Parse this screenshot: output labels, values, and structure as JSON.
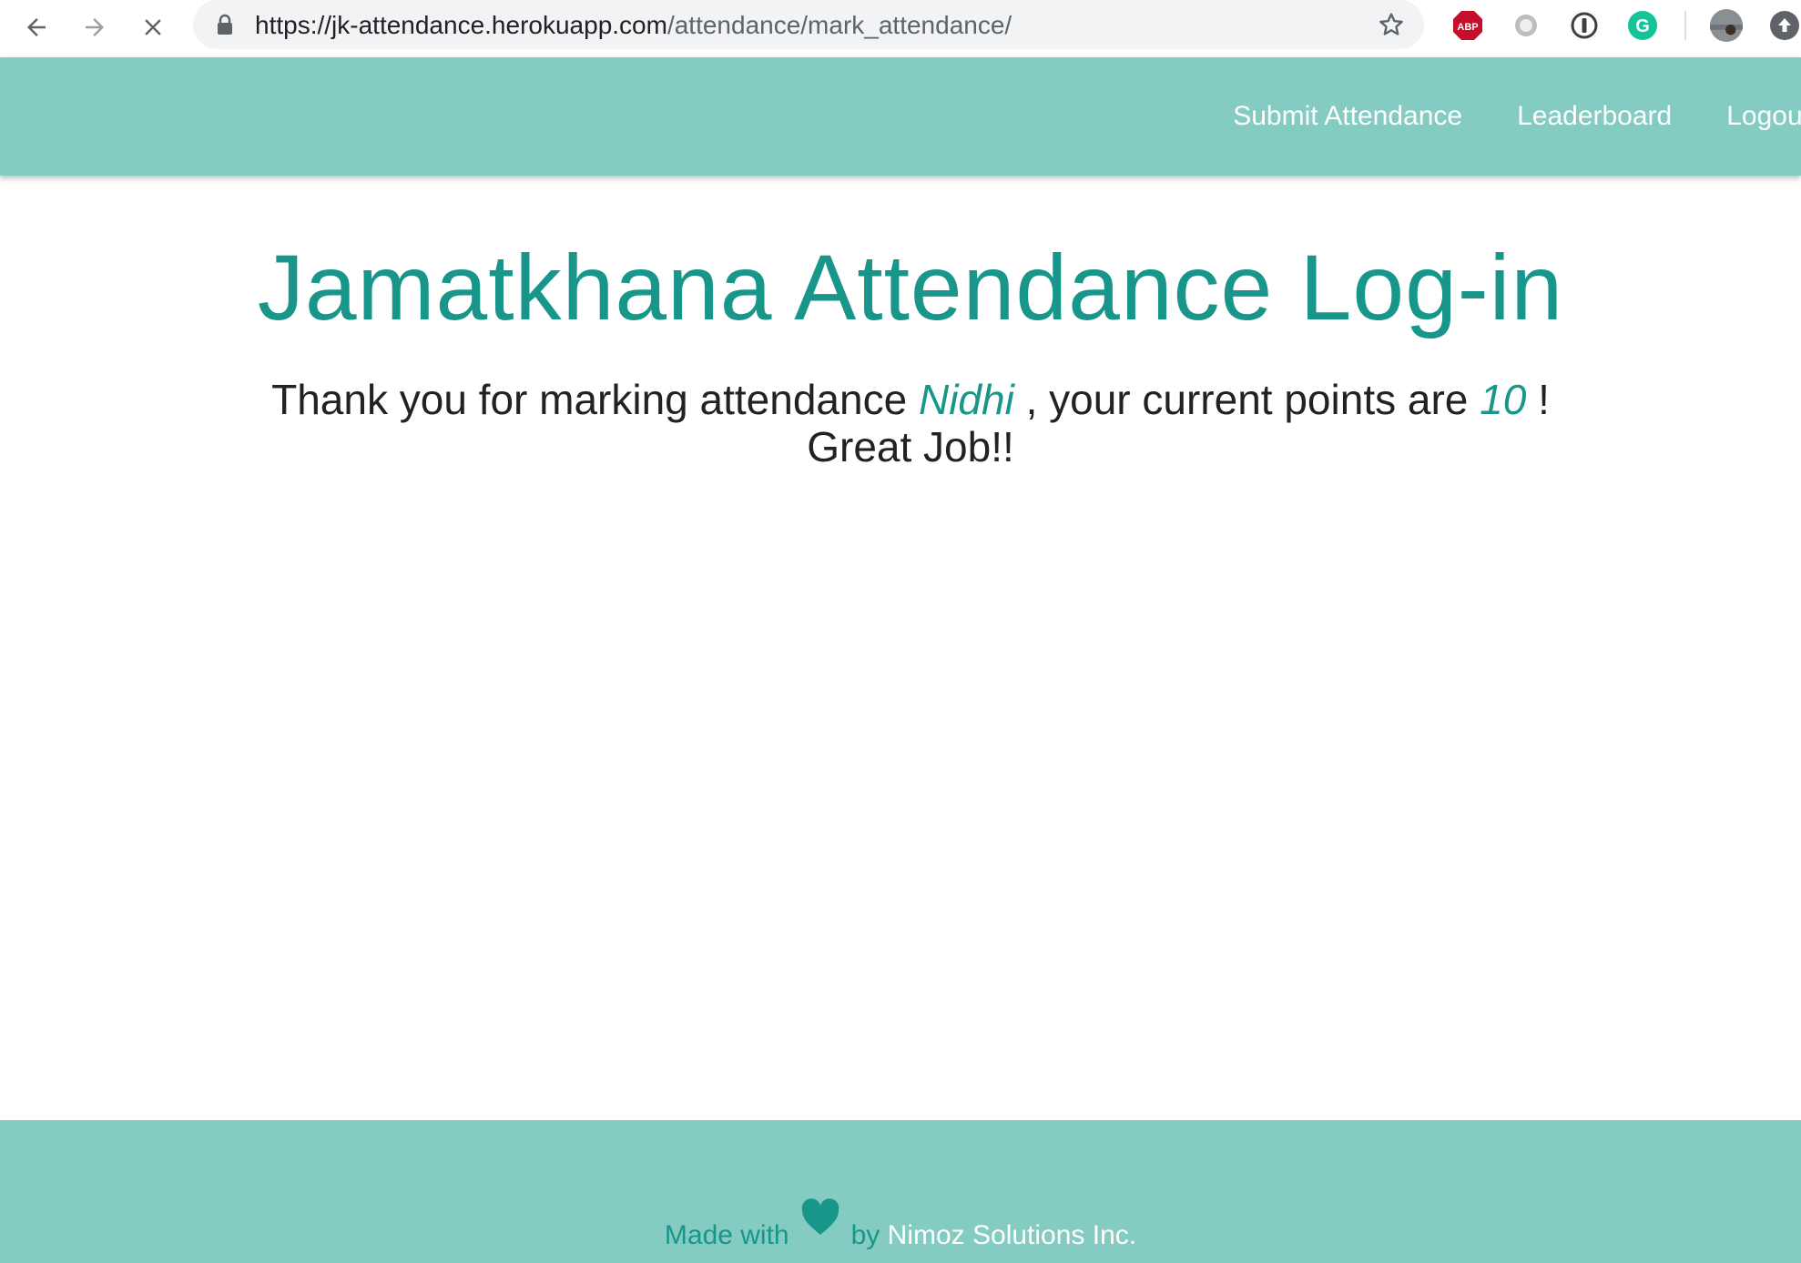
{
  "browser": {
    "url_host": "https://jk-attendance.herokuapp.com",
    "url_path": "/attendance/mark_attendance/",
    "extensions": [
      "abp-icon",
      "circle-extension-icon",
      "password-manager-icon",
      "grammarly-icon"
    ],
    "abp_label": "ABP",
    "grammarly_label": "G"
  },
  "header": {
    "nav": [
      {
        "label": "Submit Attendance"
      },
      {
        "label": "Leaderboard"
      },
      {
        "label": "Logout"
      }
    ]
  },
  "main": {
    "title": "Jamatkhana Attendance Log-in",
    "message_prefix": "Thank you for marking attendance",
    "user_name": "Nidhi",
    "message_middle": ", your current points are",
    "points": "10",
    "message_suffix": "!",
    "message_line2": "Great Job!!"
  },
  "footer": {
    "made_with": "Made with",
    "by": "by",
    "company": "Nimoz Solutions Inc."
  },
  "colors": {
    "header_bg": "#84cbc1",
    "accent": "#19968a"
  }
}
